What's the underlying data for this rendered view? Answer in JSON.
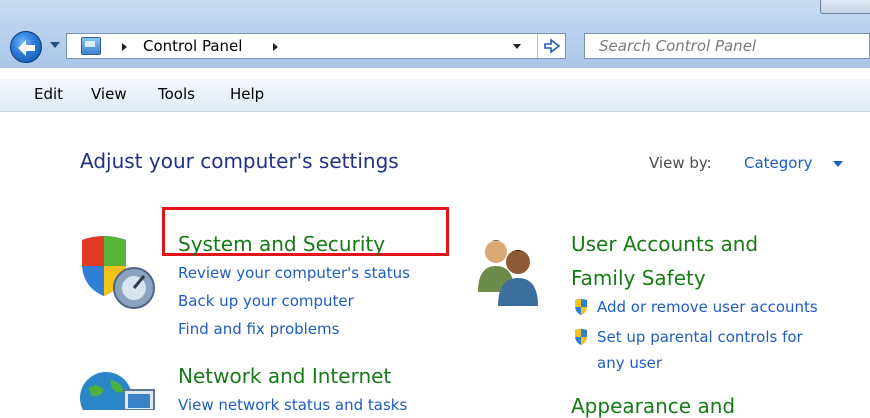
{
  "address_bar": {
    "breadcrumb": [
      "Control Panel"
    ],
    "search_placeholder": "Search Control Panel"
  },
  "menu": {
    "items": [
      "Edit",
      "View",
      "Tools",
      "Help"
    ]
  },
  "main": {
    "heading": "Adjust your computer's settings",
    "view_by_label": "View by:",
    "view_by_value": "Category",
    "categories": [
      {
        "title": "System and Security",
        "highlighted": true,
        "tasks": [
          "Review your computer's status",
          "Back up your computer",
          "Find and fix problems"
        ]
      },
      {
        "title": "Network and Internet",
        "tasks": [
          "View network status and tasks"
        ]
      },
      {
        "title_line1": "User Accounts and",
        "title_line2": "Family Safety",
        "tasks": [
          "Add or remove user accounts",
          "Set up parental controls for",
          "any user"
        ]
      },
      {
        "title": "Appearance and"
      }
    ]
  },
  "colors": {
    "category_title": "#177a16",
    "task_link": "#1f5cc4",
    "heading": "#1e3287",
    "highlight_border": "#e3121b"
  },
  "icons": [
    "back-arrow-icon",
    "history-dropdown-icon",
    "control-panel-icon",
    "refresh-icon",
    "system-security-shield-icon",
    "user-accounts-icon",
    "network-globe-icon",
    "uac-shield-icon"
  ]
}
